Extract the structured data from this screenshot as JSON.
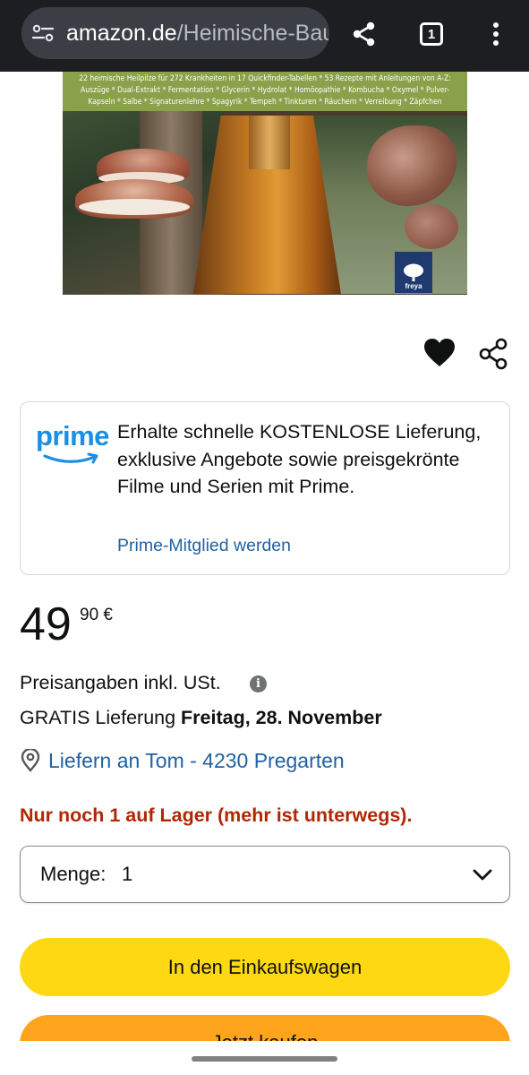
{
  "browser": {
    "url_domain": "amazon.de",
    "url_path": "/Heimische-Bau",
    "tab_count": "1",
    "icons": [
      "site-settings-icon",
      "share-icon",
      "tabs-icon",
      "more-vert-icon"
    ]
  },
  "cover": {
    "band_line1": "22 heimische Heilpilze für 272 Krankheiten in 17 Quickfinder-Tabellen * 53 Rezepte mit Anleitungen von A-Z:",
    "band_line2": "Auszüge * Dual-Extrakt * Fermentation * Glycerin * Hydrolat * Homöopathie * Kombucha * Oxymel * Pulver-",
    "band_line3": "Kapseln * Salbe * Signaturenlehre * Spagyrik * Tempeh * Tinkturen * Räuchern * Verreibung * Zäpfchen",
    "publisher": "freya"
  },
  "actions": {
    "icons": [
      "heart-icon",
      "share-icon"
    ]
  },
  "prime": {
    "logo_text": "prime",
    "message": "Erhalte schnelle KOSTENLOSE Lieferung, exklusive Angebote sowie preisgekrönte Filme und Serien mit Prime.",
    "link": "Prime-Mitglied werden",
    "brand_color": "#1a8fe3"
  },
  "price": {
    "whole": "49",
    "fraction_currency": "90 €"
  },
  "vat_text": "Preisangaben inkl. USt.",
  "delivery": {
    "prefix": "GRATIS Lieferung ",
    "date": "Freitag, 28. November"
  },
  "location": {
    "text": "Liefern an Tom - 4230 Pregarten"
  },
  "stock_text": "Nur noch 1 auf Lager (mehr ist unterwegs).",
  "quantity": {
    "label": "Menge:",
    "value": "1"
  },
  "buttons": {
    "cart": "In den Einkaufswagen",
    "buy": "Jetzt kaufen",
    "cart_color": "#ffd814",
    "buy_color": "#ffa41c"
  },
  "colors": {
    "link": "#2162a1",
    "stock": "#b12704",
    "browser_bar": "#1c1e22"
  }
}
